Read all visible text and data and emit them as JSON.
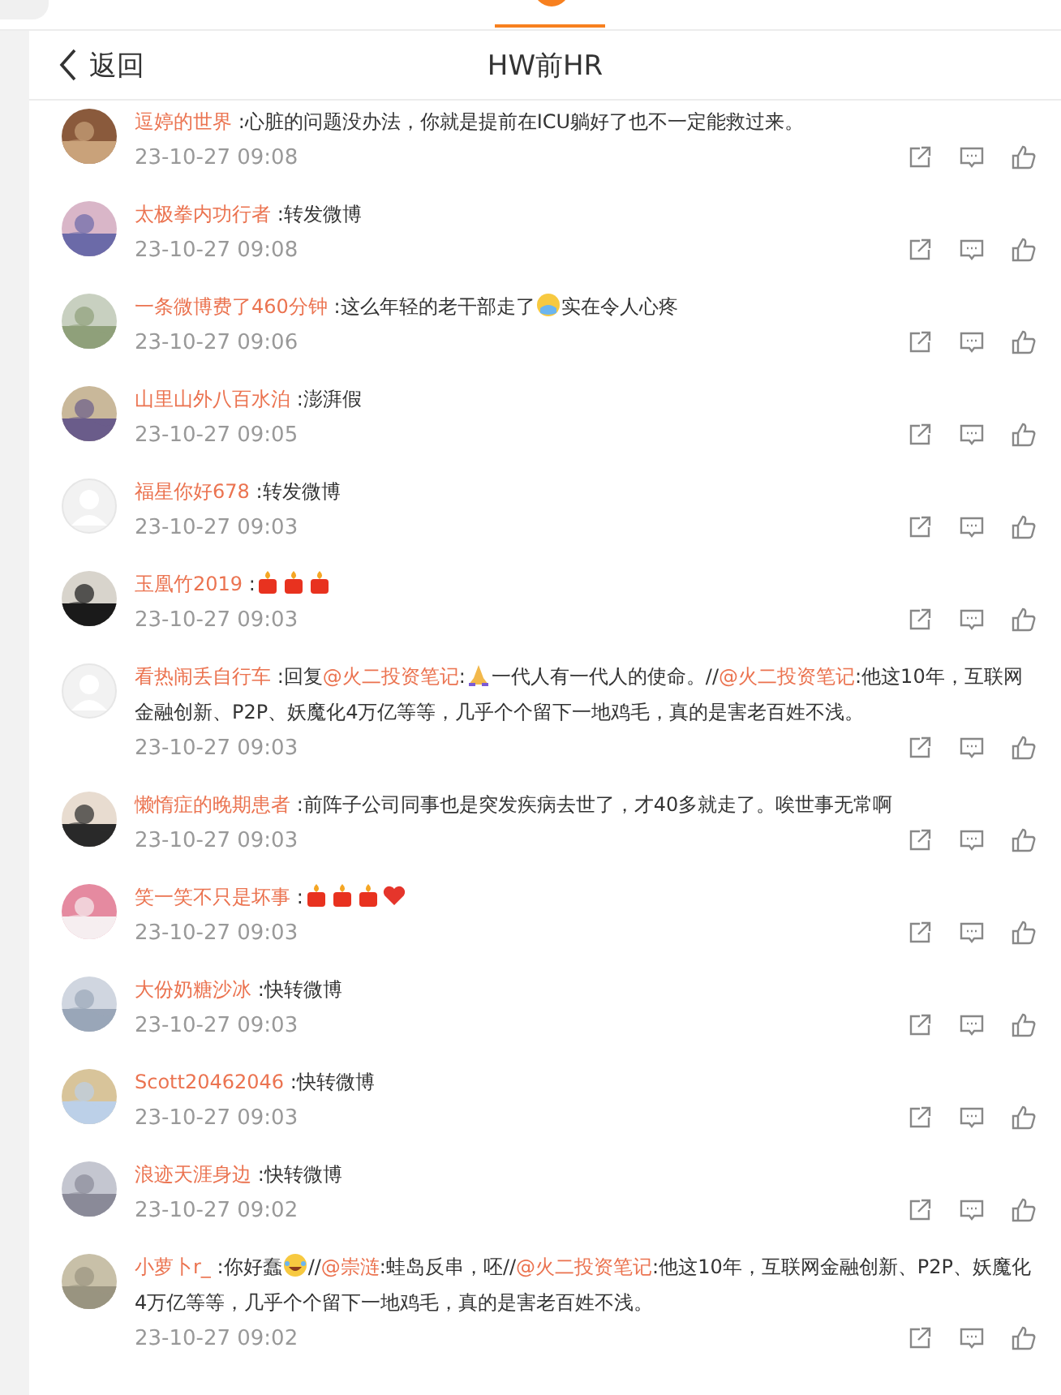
{
  "header": {
    "back_label": "返回",
    "title": "HW前HR"
  },
  "comments": [
    {
      "avatar": {
        "kind": "picture"
      },
      "name": "逗婷的世界",
      "content": [
        {
          "kind": "text",
          "text": ":心脏的问题没办法，你就是提前在ICU躺好了也不一定能救过来。"
        }
      ],
      "time": "23-10-27 09:08"
    },
    {
      "avatar": {
        "kind": "picture"
      },
      "name": "太极拳内功行者",
      "content": [
        {
          "kind": "text",
          "text": ":转发微博"
        }
      ],
      "time": "23-10-27 09:08"
    },
    {
      "avatar": {
        "kind": "picture"
      },
      "name": "一条微博费了460分钟",
      "content": [
        {
          "kind": "text",
          "text": ":这么年轻的老干部走了"
        },
        {
          "kind": "crying"
        },
        {
          "kind": "text",
          "text": "实在令人心疼"
        }
      ],
      "time": "23-10-27 09:06"
    },
    {
      "avatar": {
        "kind": "picture"
      },
      "name": "山里山外八百水泊",
      "content": [
        {
          "kind": "text",
          "text": ":澎湃假"
        }
      ],
      "time": "23-10-27 09:05"
    },
    {
      "avatar": {
        "kind": "default"
      },
      "name": "福星你好678",
      "content": [
        {
          "kind": "text",
          "text": ":转发微博"
        }
      ],
      "time": "23-10-27 09:03"
    },
    {
      "avatar": {
        "kind": "picture"
      },
      "name": "玉凰竹2019",
      "content": [
        {
          "kind": "text",
          "text": ":"
        },
        {
          "kind": "candle"
        },
        {
          "kind": "candle"
        },
        {
          "kind": "candle"
        }
      ],
      "time": "23-10-27 09:03"
    },
    {
      "avatar": {
        "kind": "default"
      },
      "name": "看热闹丢自行车",
      "content": [
        {
          "kind": "text",
          "text": ":回复"
        },
        {
          "kind": "mention",
          "text": "@火二投资笔记"
        },
        {
          "kind": "text",
          "text": ":"
        },
        {
          "kind": "praying"
        },
        {
          "kind": "text",
          "text": "一代人有一代人的使命。//"
        },
        {
          "kind": "mention",
          "text": "@火二投资笔记"
        },
        {
          "kind": "text",
          "text": ":他这10年，互联网金融创新、P2P、妖魔化4万亿等等，几乎个个留下一地鸡毛，真的是害老百姓不浅。"
        }
      ],
      "time": "23-10-27 09:03"
    },
    {
      "avatar": {
        "kind": "picture"
      },
      "name": "懒惰症的晚期患者",
      "content": [
        {
          "kind": "text",
          "text": ":前阵子公司同事也是突发疾病去世了，才40多就走了。唉世事无常啊"
        }
      ],
      "time": "23-10-27 09:03"
    },
    {
      "avatar": {
        "kind": "picture"
      },
      "name": "笑一笑不只是坏事",
      "content": [
        {
          "kind": "text",
          "text": ":"
        },
        {
          "kind": "candle"
        },
        {
          "kind": "candle"
        },
        {
          "kind": "candle"
        },
        {
          "kind": "heart"
        }
      ],
      "time": "23-10-27 09:03"
    },
    {
      "avatar": {
        "kind": "picture"
      },
      "name": "大份奶糖沙冰",
      "content": [
        {
          "kind": "text",
          "text": ":快转微博"
        }
      ],
      "time": "23-10-27 09:03"
    },
    {
      "avatar": {
        "kind": "picture"
      },
      "name": "Scott20462046",
      "content": [
        {
          "kind": "text",
          "text": ":快转微博"
        }
      ],
      "time": "23-10-27 09:03"
    },
    {
      "avatar": {
        "kind": "picture"
      },
      "name": "浪迹天涯身边",
      "content": [
        {
          "kind": "text",
          "text": ":快转微博"
        }
      ],
      "time": "23-10-27 09:02"
    },
    {
      "avatar": {
        "kind": "picture"
      },
      "name": "小萝卜r_",
      "content": [
        {
          "kind": "text",
          "text": ":你好蠢"
        },
        {
          "kind": "laughing"
        },
        {
          "kind": "text",
          "text": "//"
        },
        {
          "kind": "mention",
          "text": "@崇涟"
        },
        {
          "kind": "text",
          "text": ":蛙岛反串，呸//"
        },
        {
          "kind": "mention",
          "text": "@火二投资笔记"
        },
        {
          "kind": "text",
          "text": ":他这10年，互联网金融创新、P2P、妖魔化4万亿等等，几乎个个留下一地鸡毛，真的是害老百姓不浅。"
        }
      ],
      "time": "23-10-27 09:02"
    }
  ]
}
